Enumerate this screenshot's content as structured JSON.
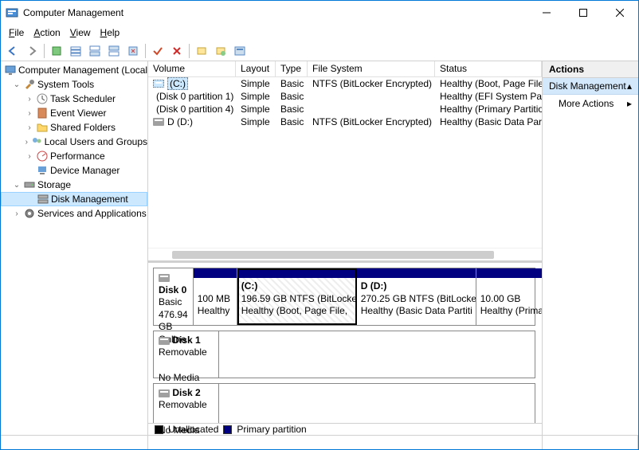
{
  "window": {
    "title": "Computer Management"
  },
  "menu": {
    "file": "File",
    "action": "Action",
    "view": "View",
    "help": "Help"
  },
  "tree": {
    "root": "Computer Management (Local",
    "systools": "System Tools",
    "task": "Task Scheduler",
    "event": "Event Viewer",
    "shared": "Shared Folders",
    "users": "Local Users and Groups",
    "perf": "Performance",
    "devmgr": "Device Manager",
    "storage": "Storage",
    "diskmgmt": "Disk Management",
    "services": "Services and Applications"
  },
  "cols": {
    "volume": "Volume",
    "layout": "Layout",
    "type": "Type",
    "fs": "File System",
    "status": "Status"
  },
  "vols": [
    {
      "name": "(C:)",
      "layout": "Simple",
      "type": "Basic",
      "fs": "NTFS (BitLocker Encrypted)",
      "status": "Healthy (Boot, Page File, Crash Dump, Basi",
      "sel": true
    },
    {
      "name": "(Disk 0 partition 1)",
      "layout": "Simple",
      "type": "Basic",
      "fs": "",
      "status": "Healthy (EFI System Partition)",
      "sel": false
    },
    {
      "name": "(Disk 0 partition 4)",
      "layout": "Simple",
      "type": "Basic",
      "fs": "",
      "status": "Healthy (Primary Partition)",
      "sel": false
    },
    {
      "name": "D (D:)",
      "layout": "Simple",
      "type": "Basic",
      "fs": "NTFS (BitLocker Encrypted)",
      "status": "Healthy (Basic Data Partition)",
      "sel": false
    }
  ],
  "disks": {
    "d0": {
      "name": "Disk 0",
      "type": "Basic",
      "size": "476.94 GB",
      "state": "Online"
    },
    "d1": {
      "name": "Disk 1",
      "type": "Removable",
      "state": "No Media"
    },
    "d2": {
      "name": "Disk 2",
      "type": "Removable",
      "state": "No Media"
    }
  },
  "parts": {
    "p0": {
      "l1": "100 MB",
      "l2": "Healthy"
    },
    "p1": {
      "l0": "(C:)",
      "l1": "196.59 GB NTFS (BitLocke",
      "l2": "Healthy (Boot, Page File,"
    },
    "p2": {
      "l0": "D  (D:)",
      "l1": "270.25 GB NTFS (BitLocke",
      "l2": "Healthy (Basic Data Partiti"
    },
    "p3": {
      "l1": "10.00 GB",
      "l2": "Healthy (Primary P"
    }
  },
  "legend": {
    "unalloc": "Unallocated",
    "primary": "Primary partition"
  },
  "actions": {
    "header": "Actions",
    "node": "Disk Management",
    "more": "More Actions"
  }
}
